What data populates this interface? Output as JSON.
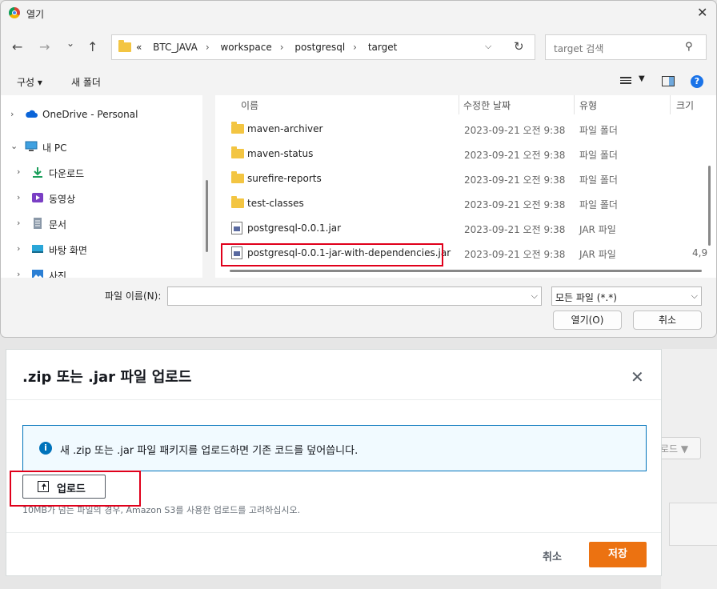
{
  "dialog": {
    "title": "열기",
    "nav": {
      "back": "←",
      "forward": "→",
      "recent": "⌄",
      "up": "↑"
    },
    "address": {
      "prefix": "«",
      "crumbs": [
        "BTC_JAVA",
        "workspace",
        "postgresql",
        "target"
      ]
    },
    "search_placeholder": "target 검색",
    "toolbar": {
      "organize": "구성 ▾",
      "new_folder": "새 폴더"
    },
    "tree": [
      {
        "label": "OneDrive - Personal",
        "icon": "cloud-icon"
      },
      {
        "label": "내 PC",
        "icon": "pc-icon"
      },
      {
        "label": "다운로드",
        "icon": "download-icon"
      },
      {
        "label": "동영상",
        "icon": "video-icon"
      },
      {
        "label": "문서",
        "icon": "document-icon"
      },
      {
        "label": "바탕 화면",
        "icon": "desktop-icon"
      },
      {
        "label": "사진",
        "icon": "picture-icon"
      }
    ],
    "columns": {
      "name": "이름",
      "date": "수정한 날짜",
      "type": "유형",
      "size": "크기"
    },
    "files": [
      {
        "name": "maven-archiver",
        "date": "2023-09-21 오전 9:38",
        "type": "파일 폴더",
        "size": "",
        "kind": "folder"
      },
      {
        "name": "maven-status",
        "date": "2023-09-21 오전 9:38",
        "type": "파일 폴더",
        "size": "",
        "kind": "folder"
      },
      {
        "name": "surefire-reports",
        "date": "2023-09-21 오전 9:38",
        "type": "파일 폴더",
        "size": "",
        "kind": "folder"
      },
      {
        "name": "test-classes",
        "date": "2023-09-21 오전 9:38",
        "type": "파일 폴더",
        "size": "",
        "kind": "folder"
      },
      {
        "name": "postgresql-0.0.1.jar",
        "date": "2023-09-21 오전 9:38",
        "type": "JAR 파일",
        "size": "",
        "kind": "jar"
      },
      {
        "name": "postgresql-0.0.1-jar-with-dependencies.jar",
        "date": "2023-09-21 오전 9:38",
        "type": "JAR 파일",
        "size": "4,9",
        "kind": "jar"
      }
    ],
    "filename_label": "파일 이름(N):",
    "filename_value": "",
    "filetype": "모든 파일 (*.*)",
    "open_button": "열기(O)",
    "cancel_button": "취소"
  },
  "modal": {
    "title": ".zip 또는 .jar 파일 업로드",
    "info": "새 .zip 또는 .jar 파일 패키지를 업로드하면 기존 코드를 덮어씁니다.",
    "upload_button": "업로드",
    "hint": "10MB가 넘는 파일의 경우, Amazon S3를 사용한 업로드를 고려하십시오.",
    "cancel": "취소",
    "save": "저장"
  },
  "background": {
    "ghost_button": "로드 ▼"
  },
  "colors": {
    "accent": "#ec7211",
    "info": "#0073bb",
    "highlight": "#e0001b"
  }
}
